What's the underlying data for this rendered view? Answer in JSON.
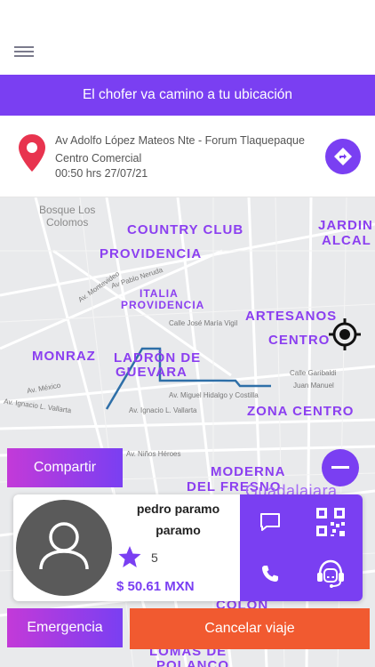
{
  "status_banner": "El chofer va camino a tu ubicación",
  "address": {
    "line1": "Av Adolfo López Mateos Nte - Forum Tlaquepaque",
    "line2": "Centro Comercial",
    "time": "00:50 hrs 27/07/21"
  },
  "map": {
    "neighborhoods": [
      "COUNTRY CLUB",
      "PROVIDENCIA",
      "ITALIA",
      "PROVIDENCIA",
      "ARTESANOS",
      "CENTRO",
      "MONRAZ",
      "LADRÓN DE",
      "GUEVARA",
      "ZONA CENTRO",
      "MODERNA",
      "DEL FRESNO",
      "Guadalajara",
      "COLÓN",
      "LOMAS DE",
      "POLANCO",
      "JARDIN",
      "ALCAL"
    ],
    "streets": [
      "Av Pablo Neruda",
      "Av. Montevideo",
      "Calle José María Vigil",
      "Av. México",
      "Av. Ignacio L. Vallarta",
      "Av. Miguel Hidalgo y Costilla",
      "Calle Garibaldi",
      "Juan Manuel",
      "Av. Niños Héroes"
    ],
    "poi": [
      "Bosque Los",
      "Colomos"
    ],
    "route_color": "#2e6fa8"
  },
  "buttons": {
    "share": "Compartir",
    "emergency": "Emergencia",
    "cancel": "Cancelar viaje"
  },
  "driver": {
    "name_first": "pedro paramo",
    "name_last": "paramo",
    "rating": "5",
    "fare": "$ 50.61 MXN"
  },
  "icons": {
    "menu": "hamburger-icon",
    "pin": "location-pin-icon",
    "directions": "directions-icon",
    "locate": "crosshair-icon",
    "zoom_out": "minus-icon",
    "chat": "chat-icon",
    "qr": "qr-code-icon",
    "phone": "phone-icon",
    "support": "support-agent-icon",
    "star": "star-icon",
    "avatar": "user-icon"
  },
  "colors": {
    "brand": "#7a3ff2",
    "danger": "#f15a30",
    "pin": "#e8344f"
  }
}
